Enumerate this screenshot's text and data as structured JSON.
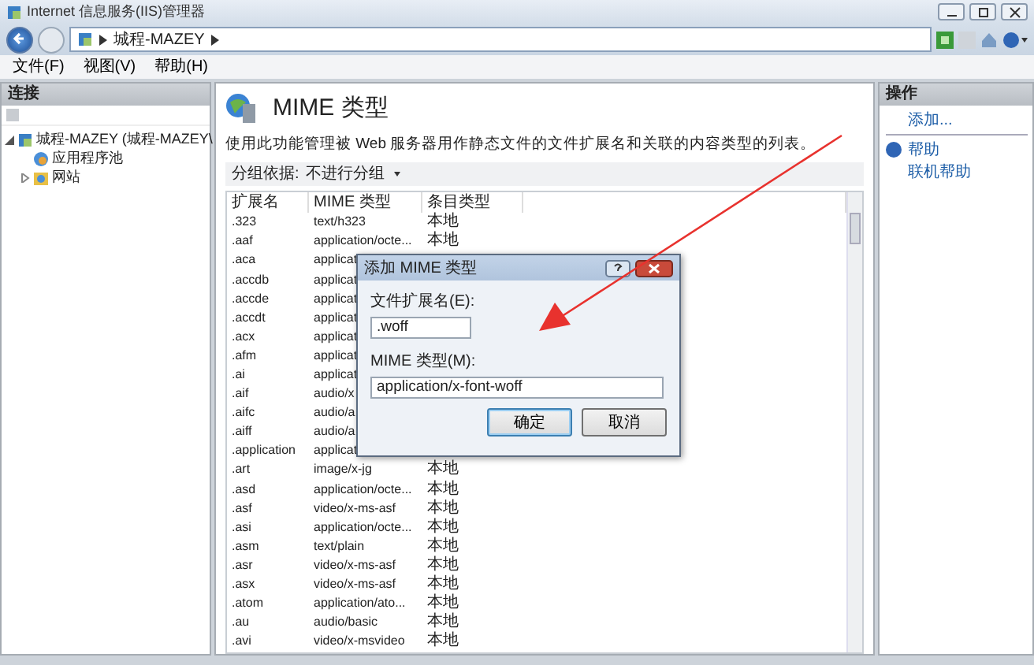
{
  "window": {
    "title": "Internet 信息服务(IIS)管理器"
  },
  "address": {
    "crumbs": [
      "城程-MAZEY"
    ]
  },
  "menu": [
    "文件(F)",
    "视图(V)",
    "帮助(H)"
  ],
  "connections": {
    "title": "连接",
    "tree": [
      {
        "label": "城程-MAZEY (城程-MAZEY\\",
        "expanded": true,
        "children": [
          {
            "label": "应用程序池",
            "kind": "pool"
          },
          {
            "label": "网站",
            "kind": "sites",
            "expanded": false
          }
        ]
      }
    ]
  },
  "feature": {
    "title": "MIME 类型",
    "description": "使用此功能管理被 Web 服务器用作静态文件的文件扩展名和关联的内容类型的列表。",
    "group_label": "分组依据:",
    "group_value": "不进行分组"
  },
  "table": {
    "columns": [
      "扩展名",
      "MIME 类型",
      "条目类型"
    ],
    "rows": [
      {
        "ext": ".323",
        "mime": "text/h323",
        "type": "本地"
      },
      {
        "ext": ".aaf",
        "mime": "application/octe...",
        "type": "本地"
      },
      {
        "ext": ".aca",
        "mime": "applicat"
      },
      {
        "ext": ".accdb",
        "mime": "applicat"
      },
      {
        "ext": ".accde",
        "mime": "applicat"
      },
      {
        "ext": ".accdt",
        "mime": "applicat"
      },
      {
        "ext": ".acx",
        "mime": "applicat"
      },
      {
        "ext": ".afm",
        "mime": "applicat"
      },
      {
        "ext": ".ai",
        "mime": "applicat"
      },
      {
        "ext": ".aif",
        "mime": "audio/x"
      },
      {
        "ext": ".aifc",
        "mime": "audio/a"
      },
      {
        "ext": ".aiff",
        "mime": "audio/a"
      },
      {
        "ext": ".application",
        "mime": "applicat"
      },
      {
        "ext": ".art",
        "mime": "image/x-jg",
        "type": "本地"
      },
      {
        "ext": ".asd",
        "mime": "application/octe...",
        "type": "本地"
      },
      {
        "ext": ".asf",
        "mime": "video/x-ms-asf",
        "type": "本地"
      },
      {
        "ext": ".asi",
        "mime": "application/octe...",
        "type": "本地"
      },
      {
        "ext": ".asm",
        "mime": "text/plain",
        "type": "本地"
      },
      {
        "ext": ".asr",
        "mime": "video/x-ms-asf",
        "type": "本地"
      },
      {
        "ext": ".asx",
        "mime": "video/x-ms-asf",
        "type": "本地"
      },
      {
        "ext": ".atom",
        "mime": "application/ato...",
        "type": "本地"
      },
      {
        "ext": ".au",
        "mime": "audio/basic",
        "type": "本地"
      },
      {
        "ext": ".avi",
        "mime": "video/x-msvideo",
        "type": "本地"
      }
    ]
  },
  "actions": {
    "title": "操作",
    "items": [
      {
        "label": "添加...",
        "kind": "plain"
      },
      {
        "label": "帮助",
        "kind": "help"
      },
      {
        "label": "联机帮助",
        "kind": "plain"
      }
    ]
  },
  "dialog": {
    "title": "添加 MIME 类型",
    "fields": [
      {
        "label": "文件扩展名(E):",
        "value": ".woff"
      },
      {
        "label": "MIME 类型(M):",
        "value": "application/x-font-woff"
      }
    ],
    "buttons": [
      {
        "label": "确定",
        "default": true
      },
      {
        "label": "取消",
        "default": false
      }
    ]
  }
}
